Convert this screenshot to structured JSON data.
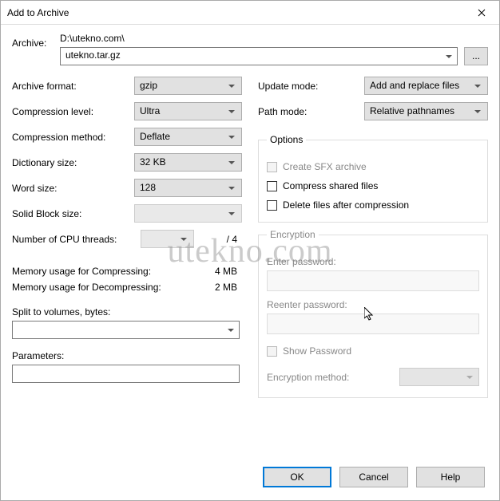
{
  "window": {
    "title": "Add to Archive"
  },
  "archive": {
    "label": "Archive:",
    "path": "D:\\utekno.com\\",
    "name": "utekno.tar.gz",
    "browse": "..."
  },
  "left": {
    "format_label": "Archive format:",
    "format": "gzip",
    "level_label": "Compression level:",
    "level": "Ultra",
    "method_label": "Compression method:",
    "method": "Deflate",
    "dict_label": "Dictionary size:",
    "dict": "32 KB",
    "word_label": "Word size:",
    "word": "128",
    "solid_label": "Solid Block size:",
    "solid": "",
    "cpu_label": "Number of CPU threads:",
    "cpu": "",
    "cpu_max": "/ 4",
    "mem_comp_label": "Memory usage for Compressing:",
    "mem_comp": "4 MB",
    "mem_decomp_label": "Memory usage for Decompressing:",
    "mem_decomp": "2 MB",
    "split_label": "Split to volumes, bytes:",
    "params_label": "Parameters:"
  },
  "right": {
    "update_label": "Update mode:",
    "update": "Add and replace files",
    "path_label": "Path mode:",
    "path": "Relative pathnames",
    "options_legend": "Options",
    "opt_sfx": "Create SFX archive",
    "opt_shared": "Compress shared files",
    "opt_delete": "Delete files after compression",
    "enc_legend": "Encryption",
    "enter_pwd": "Enter password:",
    "reenter_pwd": "Reenter password:",
    "show_pwd": "Show Password",
    "enc_method_label": "Encryption method:"
  },
  "footer": {
    "ok": "OK",
    "cancel": "Cancel",
    "help": "Help"
  },
  "watermark": "utekno.com"
}
